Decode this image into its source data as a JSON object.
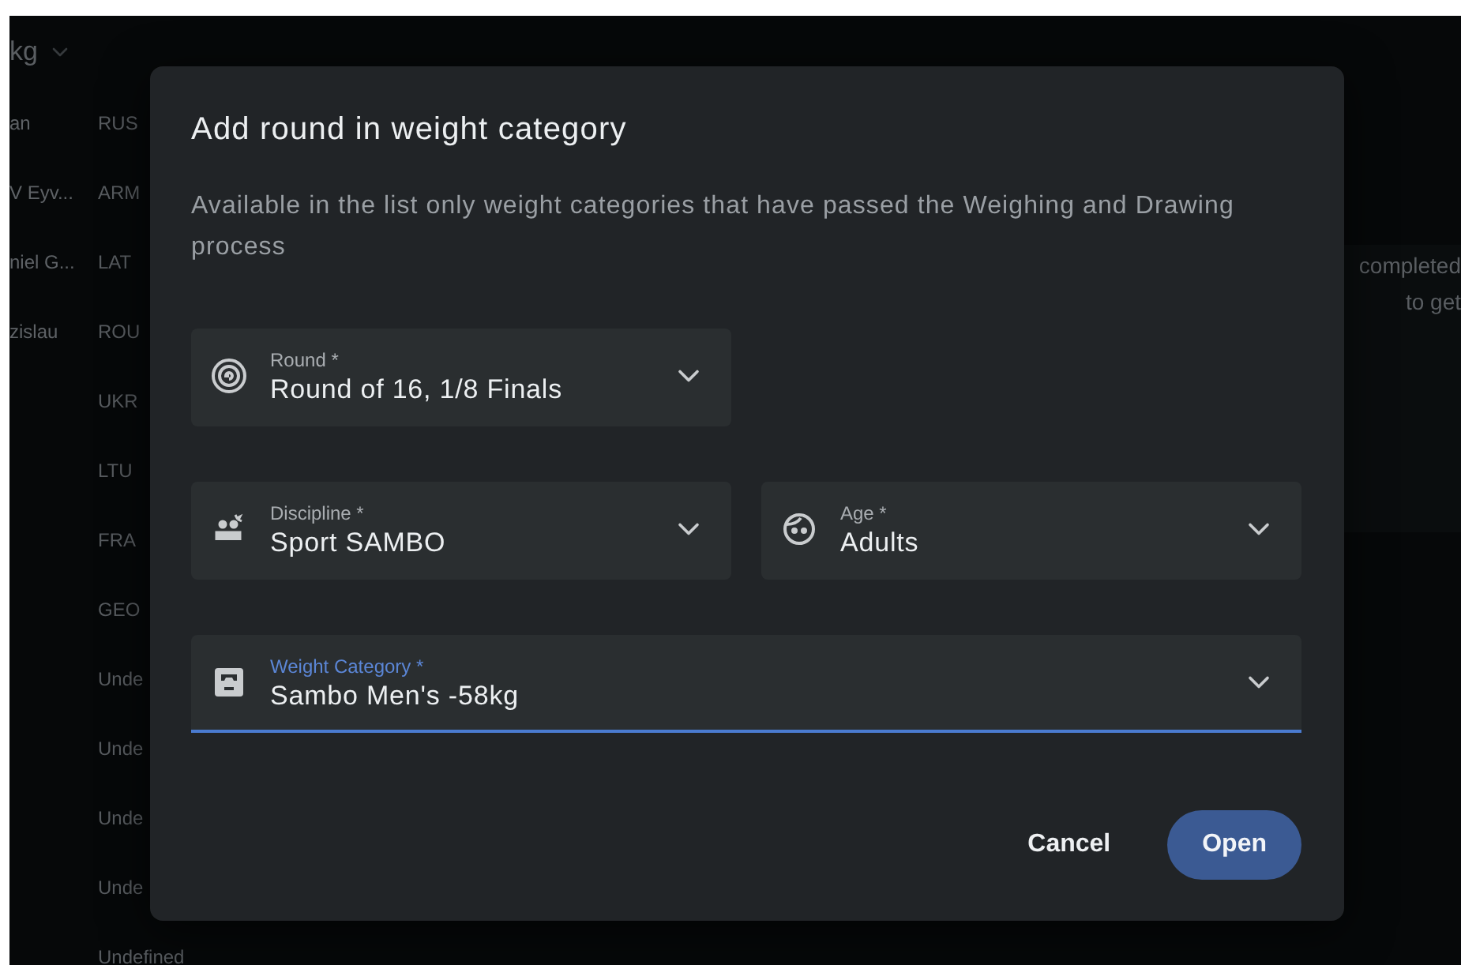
{
  "background": {
    "header": "kg",
    "rows": [
      {
        "name": "an",
        "country": "RUS"
      },
      {
        "name": "V Eyv...",
        "country": "ARM"
      },
      {
        "name": "niel G...",
        "country": "LAT"
      },
      {
        "name": "zislau",
        "country": "ROU"
      },
      {
        "name": "",
        "country": "UKR"
      },
      {
        "name": "",
        "country": "LTU"
      },
      {
        "name": "",
        "country": "FRA"
      },
      {
        "name": "",
        "country": "GEO"
      },
      {
        "name": "",
        "country": "Unde"
      },
      {
        "name": "",
        "country": "Unde"
      },
      {
        "name": "",
        "country": "Unde"
      },
      {
        "name": "",
        "country": "Unde"
      },
      {
        "name": "",
        "country": "Undefined"
      }
    ],
    "notice": [
      "completed",
      "to get"
    ]
  },
  "dialog": {
    "title": "Add round in weight category",
    "description": "Available in the list only weight categories that have passed the Weighing and Drawing process",
    "field_rows": [
      {
        "fields": [
          {
            "kind": "round",
            "label": "Round *",
            "value": "Round of 16, 1/8 Finals",
            "focused": false
          }
        ]
      },
      {
        "fields": [
          {
            "kind": "discipline",
            "label": "Discipline *",
            "value": "Sport SAMBO",
            "focused": false
          },
          {
            "kind": "age",
            "label": "Age *",
            "value": "Adults",
            "focused": false
          }
        ]
      },
      {
        "fields": [
          {
            "kind": "weight",
            "label": "Weight Category *",
            "value": "Sambo Men's -58kg",
            "focused": true
          }
        ]
      }
    ],
    "buttons": [
      {
        "kind": "text",
        "label": "Cancel"
      },
      {
        "kind": "filled",
        "label": "Open"
      }
    ]
  }
}
